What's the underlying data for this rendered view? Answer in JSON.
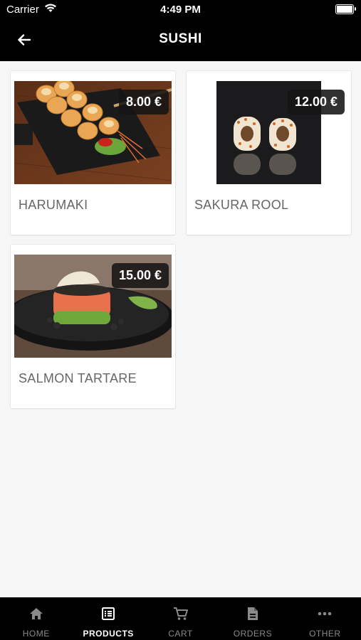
{
  "status_bar": {
    "carrier": "Carrier",
    "time": "4:49 PM"
  },
  "header": {
    "title": "SUSHI"
  },
  "products": [
    {
      "name": "HARUMAKI",
      "price": "8.00 €"
    },
    {
      "name": "SAKURA ROOL",
      "price": "12.00 €"
    },
    {
      "name": "SALMON TARTARE",
      "price": "15.00 €"
    }
  ],
  "tabs": [
    {
      "label": "HOME",
      "icon": "home-icon"
    },
    {
      "label": "PRODUCTS",
      "icon": "list-icon",
      "active": true
    },
    {
      "label": "CART",
      "icon": "cart-icon"
    },
    {
      "label": "ORDERS",
      "icon": "document-icon"
    },
    {
      "label": "OTHER",
      "icon": "more-icon"
    }
  ],
  "colors": {
    "header_bg": "#000000",
    "page_bg": "#f6f6f6",
    "price_bg": "#141414",
    "inactive_tab": "#8a8a8a"
  }
}
